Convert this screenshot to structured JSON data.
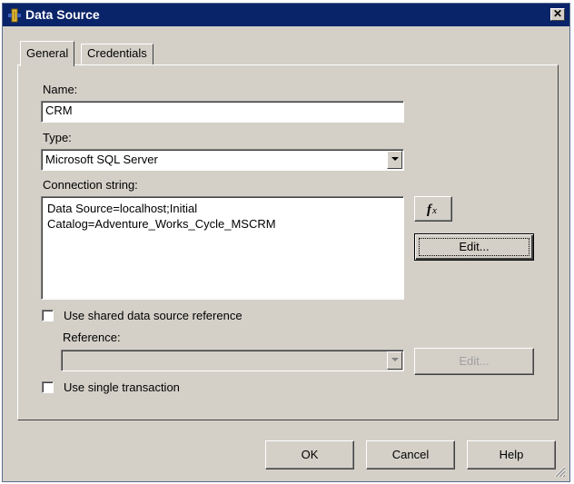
{
  "window": {
    "title": "Data Source",
    "close_glyph": "✕"
  },
  "tabs": [
    {
      "label": "General",
      "active": true
    },
    {
      "label": "Credentials",
      "active": false
    }
  ],
  "general": {
    "name_label": "Name:",
    "name_value": "CRM",
    "type_label": "Type:",
    "type_value": "Microsoft SQL Server",
    "conn_label": "Connection string:",
    "conn_line1": "Data Source=localhost;Initial",
    "conn_line2": "Catalog=Adventure_Works_Cycle_MSCRM",
    "fx_label": "fx",
    "edit_label": "Edit...",
    "shared_label": "Use shared data source reference",
    "reference_label": "Reference:",
    "reference_value": "",
    "ref_edit_label": "Edit...",
    "single_tx_label": "Use single transaction"
  },
  "footer": {
    "ok": "OK",
    "cancel": "Cancel",
    "help": "Help"
  },
  "colors": {
    "titlebar": "#0a246a",
    "face": "#d4d0c8",
    "disabled_text": "#808080"
  },
  "icons": {
    "window": "data-source-icon",
    "fx": "function-icon",
    "resize": "resize-grip-icon"
  }
}
